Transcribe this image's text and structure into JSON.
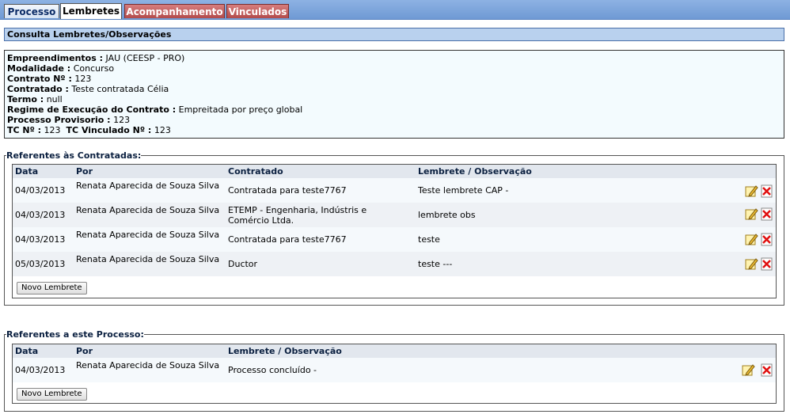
{
  "tabs": [
    {
      "label": "Processo"
    },
    {
      "label": "Lembretes"
    },
    {
      "label": "Acompanhamento"
    },
    {
      "label": "Vinculados"
    }
  ],
  "section_title": "Consulta Lembretes/Observações",
  "info": {
    "empreendimentos_label": "Empreendimentos :",
    "empreendimentos_value": "JAU (CEESP - PRO)",
    "modalidade_label": "Modalidade :",
    "modalidade_value": "Concurso",
    "contrato_label": "Contrato Nº :",
    "contrato_value": "123",
    "contratado_label": "Contratado :",
    "contratado_value": "Teste contratada Célia",
    "termo_label": "Termo :",
    "termo_value": "null",
    "regime_label": "Regime de Execução do Contrato :",
    "regime_value": "Empreitada por preço global",
    "processo_label": "Processo Provisorio :",
    "processo_value": "123",
    "tc_label": "TC Nº :",
    "tc_value": "123",
    "tcv_label": "TC Vinculado Nº :",
    "tcv_value": "123"
  },
  "contratadas": {
    "legend": "Referentes às Contratadas:",
    "headers": {
      "data": "Data",
      "por": "Por",
      "contratado": "Contratado",
      "lembrete": "Lembrete / Observação"
    },
    "rows": [
      {
        "data": "04/03/2013",
        "por": "Renata Aparecida de Souza Silva",
        "contratado": "Contratada para teste7767",
        "lembrete": "Teste lembrete CAP -"
      },
      {
        "data": "04/03/2013",
        "por": "Renata Aparecida de Souza Silva",
        "contratado": "ETEMP - Engenharia, Indústris e Comércio Ltda.",
        "lembrete": "lembrete obs"
      },
      {
        "data": "04/03/2013",
        "por": "Renata Aparecida de Souza Silva",
        "contratado": "Contratada para teste7767",
        "lembrete": "teste"
      },
      {
        "data": "05/03/2013",
        "por": "Renata Aparecida de Souza Silva",
        "contratado": "Ductor",
        "lembrete": "teste ---"
      }
    ],
    "button": "Novo Lembrete"
  },
  "processo": {
    "legend": "Referentes a este Processo:",
    "headers": {
      "data": "Data",
      "por": "Por",
      "lembrete": "Lembrete / Observação"
    },
    "rows": [
      {
        "data": "04/03/2013",
        "por": "Renata Aparecida de Souza Silva",
        "lembrete": "Processo concluído -"
      }
    ],
    "button": "Novo Lembrete"
  },
  "icons": {
    "edit": "edit-pencil-icon",
    "delete": "delete-x-icon"
  },
  "colors": {
    "tab_red": "#b24b4b",
    "title_bg": "#b9d1ee",
    "info_bg": "#f3fbfe"
  }
}
